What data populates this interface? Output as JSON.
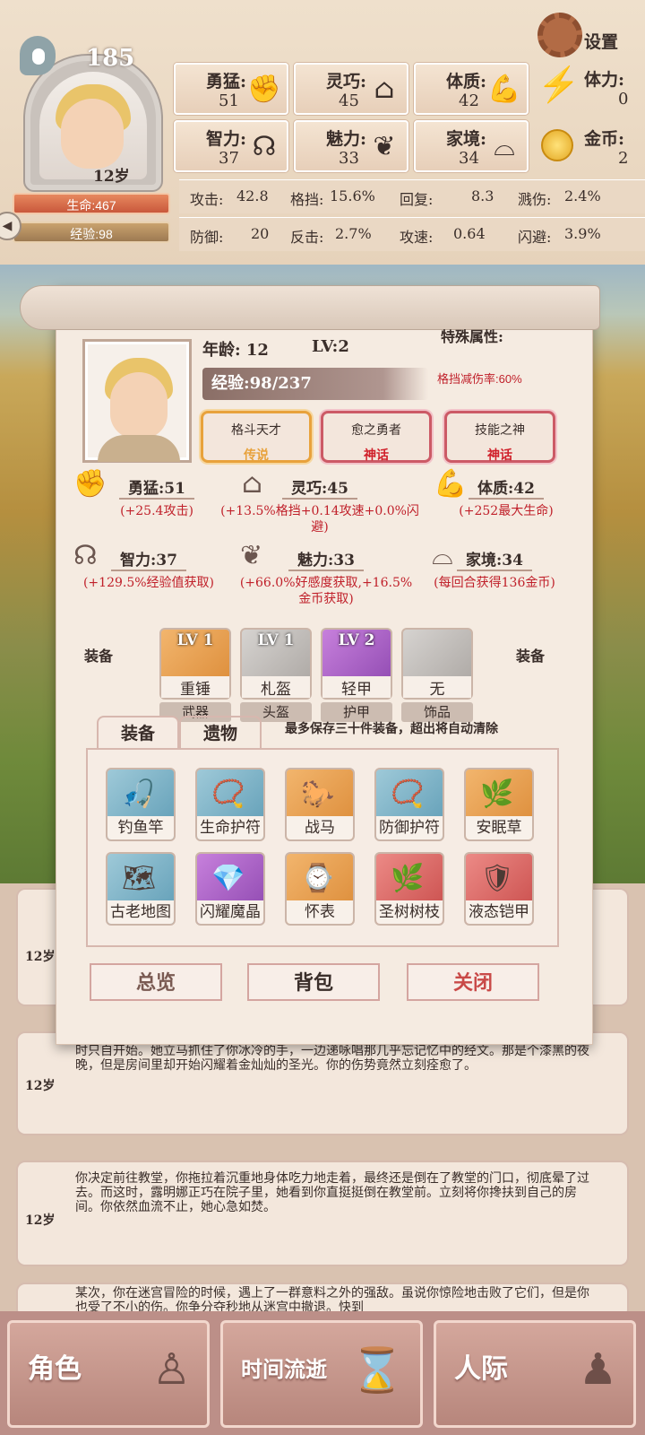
{
  "header": {
    "top_count": "185",
    "age": "12岁",
    "hp": "生命:467",
    "xp": "经验:98",
    "settings": "设置",
    "stats": [
      {
        "name": "勇猛:",
        "value": "51",
        "icon": "fist-icon"
      },
      {
        "name": "灵巧:",
        "value": "45",
        "icon": "cloak-icon"
      },
      {
        "name": "体质:",
        "value": "42",
        "icon": "muscle-icon"
      },
      {
        "name": "智力:",
        "value": "37",
        "icon": "brain-icon"
      },
      {
        "name": "魅力:",
        "value": "33",
        "icon": "bud-icon"
      },
      {
        "name": "家境:",
        "value": "34",
        "icon": "home-pedestal-icon"
      }
    ],
    "stamina": {
      "label": "体力:",
      "value": "0"
    },
    "gold": {
      "label": "金币:",
      "value": "2"
    },
    "combat": [
      {
        "label": "攻击:",
        "value": "42.8"
      },
      {
        "label": "格挡:",
        "value": "15.6%"
      },
      {
        "label": "回复:",
        "value": "8.3"
      },
      {
        "label": "溅伤:",
        "value": "2.4%"
      },
      {
        "label": "防御:",
        "value": "20"
      },
      {
        "label": "反击:",
        "value": "2.7%"
      },
      {
        "label": "攻速:",
        "value": "0.64"
      },
      {
        "label": "闪避:",
        "value": "3.9%"
      }
    ]
  },
  "panel": {
    "age": "年龄: 12",
    "level": "LV:2",
    "xp": "经验:98/237",
    "special_title": "特殊属性:",
    "special_desc": "格挡减伤率:60%",
    "traits": [
      {
        "name": "格斗天才",
        "rarity": "传说",
        "color": "#e8a23c"
      },
      {
        "name": "愈之勇者",
        "rarity": "神话",
        "color": "#d0202a"
      },
      {
        "name": "技能之神",
        "rarity": "神话",
        "color": "#d0202a"
      }
    ],
    "attrs": [
      {
        "name": "勇猛:51",
        "desc": "(+25.4攻击)"
      },
      {
        "name": "灵巧:45",
        "desc": "(+13.5%格挡+0.14攻速+0.0%闪避)"
      },
      {
        "name": "体质:42",
        "desc": "(+252最大生命)"
      },
      {
        "name": "智力:37",
        "desc": "(+129.5%经验值获取)"
      },
      {
        "name": "魅力:33",
        "desc": "(+66.0%好感度获取,+16.5%金币获取)"
      },
      {
        "name": "家境:34",
        "desc": "(每回合获得136金币)"
      }
    ],
    "equip_label": "装备",
    "equipment": [
      {
        "lv": "LV 1",
        "name": "重锤",
        "type": "武器"
      },
      {
        "lv": "LV 1",
        "name": "札盔",
        "type": "头盔"
      },
      {
        "lv": "LV 2",
        "name": "轻甲",
        "type": "护甲"
      },
      {
        "lv": "",
        "name": "无",
        "type": "饰品"
      }
    ],
    "tabs": [
      "装备",
      "遗物"
    ],
    "tab_note": "最多保存三十件装备，超出将自动清除",
    "items": [
      {
        "name": "钓鱼竿",
        "icon": "fishing-rod-icon"
      },
      {
        "name": "生命护符",
        "icon": "amulet-icon"
      },
      {
        "name": "战马",
        "icon": "horse-icon"
      },
      {
        "name": "防御护符",
        "icon": "amulet-icon"
      },
      {
        "name": "安眠草",
        "icon": "herb-icon"
      },
      {
        "name": "古老地图",
        "icon": "map-icon"
      },
      {
        "name": "闪耀魔晶",
        "icon": "crystal-icon"
      },
      {
        "name": "怀表",
        "icon": "pocket-watch-icon"
      },
      {
        "name": "圣树树枝",
        "icon": "branch-icon"
      },
      {
        "name": "液态铠甲",
        "icon": "liquid-armor-icon"
      }
    ],
    "buttons": [
      "总览",
      "背包",
      "关闭"
    ]
  },
  "log": [
    {
      "age": "12岁",
      "text": ""
    },
    {
      "age": "12岁",
      "text": "时只自开始。她立马抓住了你冰冷的手，一边递咏唱那几乎忘记忆中的经文。那是个漆黑的夜晚，但是房间里却开始闪耀着金灿灿的圣光。你的伤势竟然立刻痊愈了。"
    },
    {
      "age": "12岁",
      "text": "你决定前往教堂，你拖拉着沉重地身体吃力地走着，最终还是倒在了教堂的门口，彻底晕了过去。而这时，露明娜正巧在院子里，她看到你直挺挺倒在教堂前。立刻将你搀扶到自己的房间。你依然血流不止，她心急如焚。"
    },
    {
      "age": "",
      "text": "某次，你在迷宫冒险的时候，遇上了一群意料之外的强敌。虽说你惊险地击败了它们，但是你也受了不小的伤。你争分夺秒地从迷宫中撤退。快到"
    }
  ],
  "nav": [
    {
      "label": "角色",
      "icon": "person-icon"
    },
    {
      "label": "时间流逝",
      "icon": "hourglass-icon"
    },
    {
      "label": "人际",
      "icon": "people-icon"
    }
  ]
}
